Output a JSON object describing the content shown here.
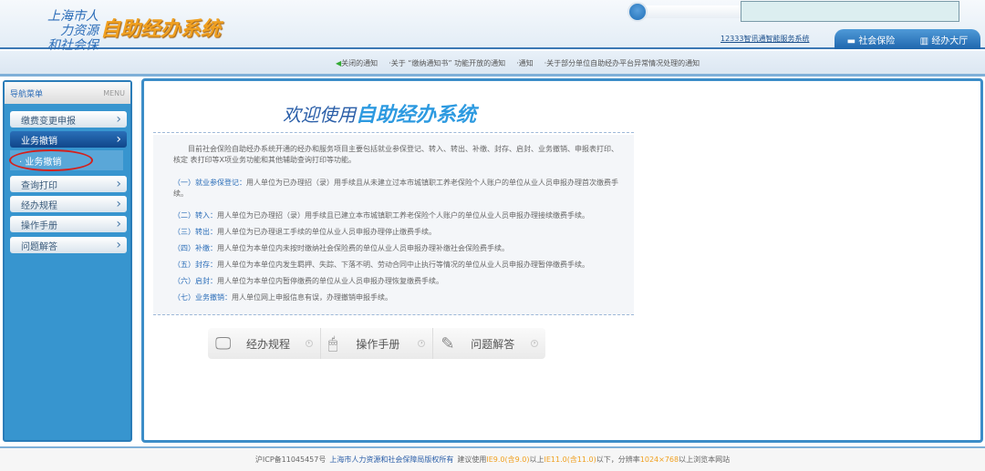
{
  "header": {
    "logo_line1": "上海市人力资源",
    "logo_line2": "和社会保障",
    "system_name": "自助经办系统",
    "service_link": "12333智讯通智能服务系统",
    "tabs": [
      {
        "label": "社会保险"
      },
      {
        "label": "经办大厅"
      }
    ]
  },
  "notices": [
    "关闭的通知",
    "关于 “缴纳通知书” 功能开放的通知",
    "通知",
    "关于部分单位自助经办平台异常情况处理的通知"
  ],
  "sidebar": {
    "title": "导航菜单",
    "menu_label": "MENU",
    "items": [
      {
        "label": "缴费变更申报"
      },
      {
        "label": "业务撤销"
      },
      {
        "label": "查询打印"
      },
      {
        "label": "经办规程"
      },
      {
        "label": "操作手册"
      },
      {
        "label": "问题解答"
      }
    ],
    "sub_item": "业务撤销"
  },
  "main": {
    "welcome_prefix": "欢迎使用",
    "welcome_name": "自助经办系统",
    "intro": "目前社会保险自助经办系统开通的经办和服务项目主要包括就业参保登记、转入、转出、补缴、封存、启封、业务撤销、申报表打印、核定 表打印等X项业务功能和其他辅助查询打印等功能。",
    "items": [
      {
        "key": "（一）就业参保登记：",
        "text": "用人单位为已办理招（录）用手续且从未建立过本市城镇职工养老保险个人账户的单位从业人员申报办理首次缴费手续。"
      },
      {
        "key": "（二）转入：",
        "text": "用人单位为已办理招（录）用手续且已建立本市城镇职工养老保险个人账户的单位从业人员申报办理接续缴费手续。"
      },
      {
        "key": "（三）转出：",
        "text": "用人单位为已办理退工手续的单位从业人员申报办理停止缴费手续。"
      },
      {
        "key": "（四）补缴：",
        "text": "用人单位为本单位内未按时缴纳社会保险费的单位从业人员申报办理补缴社会保险费手续。"
      },
      {
        "key": "（五）封存：",
        "text": "用人单位为本单位内发生羁押、失踪、下落不明、劳动合同中止执行等情况的单位从业人员申报办理暂停缴费手续。"
      },
      {
        "key": "（六）启封：",
        "text": "用人单位为本单位内暂停缴费的单位从业人员申报办理恢复缴费手续。"
      },
      {
        "key": "（七）业务撤销：",
        "text": "用人单位网上申报信息有误，办理撤销申报手续。"
      }
    ],
    "quick": [
      {
        "label": "经办规程"
      },
      {
        "label": "操作手册"
      },
      {
        "label": "问题解答"
      }
    ]
  },
  "footer": {
    "icp": "沪ICP备11045457号",
    "owner": "上海市人力资源和社会保障局版权所有",
    "t1": "建议使用",
    "ie9": "IE9.0(含9.0)",
    "t2": "以上",
    "ie11": "IE11.0(含11.0)",
    "t3": "以下，分辨率",
    "res": "1024×768",
    "t4": "以上浏览本网站"
  }
}
